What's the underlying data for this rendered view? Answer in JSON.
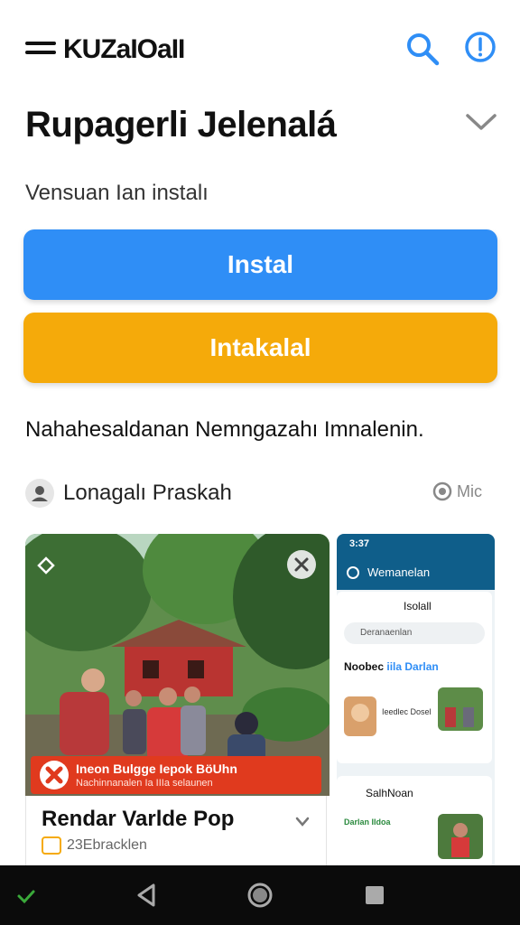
{
  "app": {
    "title": "KUZaIOaII"
  },
  "header": {
    "icons": [
      "menu-icon",
      "search-icon",
      "info-icon"
    ]
  },
  "page": {
    "title": "Rupagerli Jelenalá",
    "version_text": "Vensuan Ian  instalı"
  },
  "buttons": {
    "install_label": "Instal",
    "secondary_label": "Intakalal"
  },
  "description": "Nahahesaldanan Nemngazahı Imnalenin.",
  "developer": {
    "name": "Lonagalı Praskah",
    "mic_label": "Mic"
  },
  "screenshot1": {
    "banner_text": "Ineon Bulgge Iepok BöUhn",
    "banner_sub": "Nachinnanalen Ia IIIa selaunen"
  },
  "card": {
    "title": "Rendar Varlde Pop",
    "meta": "23Ebracklen"
  },
  "screenshot2": {
    "status_time": "3:37",
    "appbar_title": "Wemanelan",
    "panel_title": "Isolall",
    "search_text": "Deranaenlan",
    "section_title": "Noobec",
    "section_accent": "iila Darlan",
    "thumb_text": "Ieedlec Dosel",
    "row2_title": "SalhNoan",
    "row2_text": "Darlan IIdoa"
  },
  "colors": {
    "accent_blue": "#2f8ef6",
    "accent_orange": "#f5aa0a",
    "banner_red": "#e03a1e",
    "nav_dark": "#0b0b0b"
  }
}
